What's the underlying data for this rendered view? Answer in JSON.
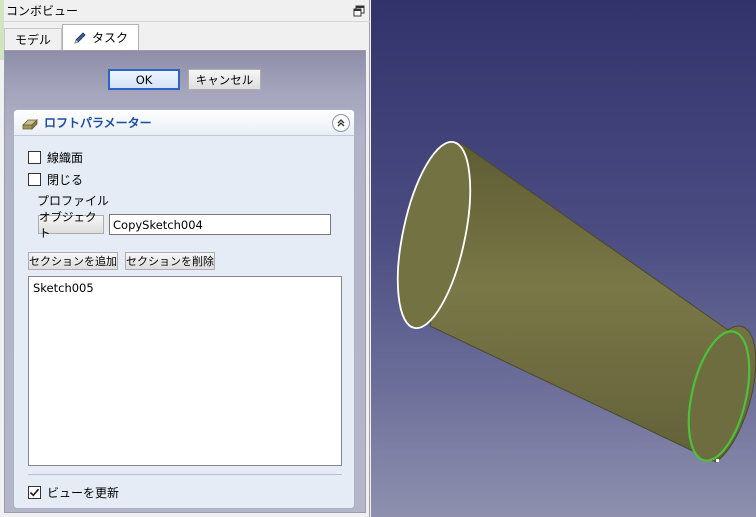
{
  "panel": {
    "title": "コンボビュー",
    "float_icon": "float-window-icon"
  },
  "tabs": [
    {
      "label": "モデル",
      "active": false
    },
    {
      "label": "タスク",
      "active": true,
      "icon": "pencil-icon"
    }
  ],
  "dialog": {
    "ok_label": "OK",
    "cancel_label": "キャンセル"
  },
  "loft": {
    "title": "ロフトパラメーター",
    "icon": "loft-icon",
    "ruled_label": "線織面",
    "ruled_checked": false,
    "closed_label": "閉じる",
    "closed_checked": false,
    "profile_label": "プロファイル",
    "object_button_label": "オブジェクト",
    "profile_value": "CopySketch004",
    "add_section_label": "セクションを追加",
    "remove_section_label": "セクションを削除",
    "sections": [
      "Sketch005"
    ],
    "update_view_label": "ビューを更新",
    "update_view_checked": true
  },
  "colors": {
    "accent": "#1b4da3",
    "solid_fill": "#6b6a3c",
    "highlight_edge": "#4cc23a",
    "profile_edge": "#ffffff"
  }
}
